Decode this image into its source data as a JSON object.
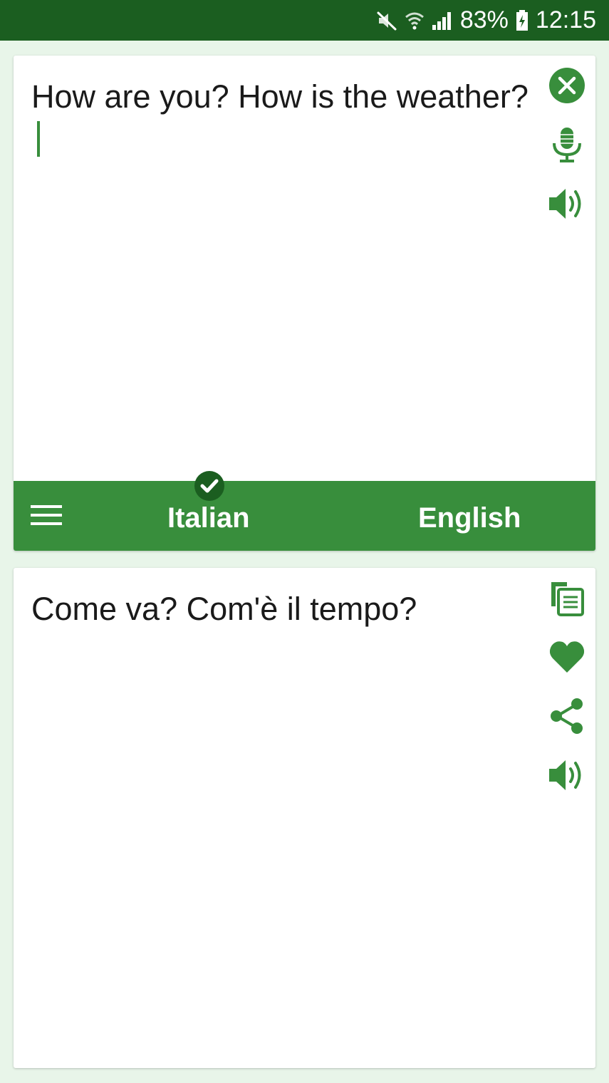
{
  "status_bar": {
    "battery_percent": "83%",
    "time": "12:15",
    "icons": [
      "mute-icon",
      "wifi-icon",
      "signal-icon",
      "battery-charging-icon"
    ]
  },
  "source": {
    "text": "How are you? How is the weather?",
    "actions": [
      "clear-icon",
      "microphone-icon",
      "speaker-icon"
    ]
  },
  "language_bar": {
    "source_language": "Italian",
    "target_language": "English",
    "menu_icon": "menu-icon",
    "selected_icon": "check-icon"
  },
  "target": {
    "text": "Come va? Com'è il tempo?",
    "actions": [
      "copy-icon",
      "favorite-icon",
      "share-icon",
      "speaker-icon"
    ]
  },
  "colors": {
    "status_bar": "#1b5e20",
    "accent": "#388e3c",
    "background": "#e8f5e9",
    "card": "#ffffff",
    "text": "#1a1a1a"
  }
}
